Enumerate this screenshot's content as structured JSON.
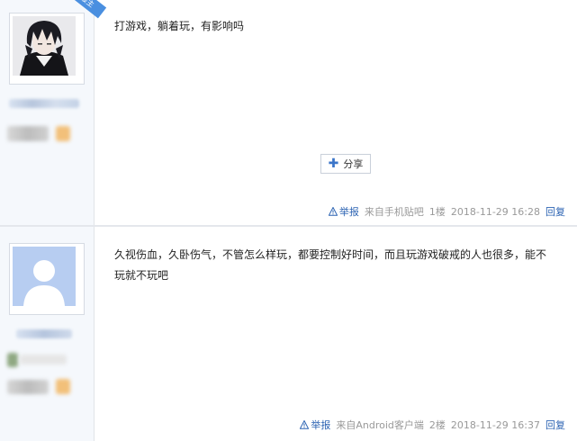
{
  "posts": [
    {
      "badge": "楼主",
      "content": "打游戏，躺着玩，有影响吗",
      "share_label": "分享",
      "report_label": "举报",
      "source": "来自手机贴吧",
      "floor": "1楼",
      "time": "2018-11-29 16:28",
      "reply_label": "回复"
    },
    {
      "content_line1": "久视伤血，久卧伤气，不管怎么样玩，都要控制好时间，而且玩游戏破戒的人也很多，能不",
      "content_line2": "玩就不玩吧",
      "report_label": "举报",
      "source": "来自Android客户端",
      "floor": "2楼",
      "time": "2018-11-29 16:37",
      "reply_label": "回复"
    }
  ],
  "colors": {
    "link": "#2d64b3",
    "badge": "#4a8fe0",
    "meta": "#999999"
  },
  "icons": [
    "warning-icon",
    "plus-icon",
    "user-placeholder-icon"
  ]
}
